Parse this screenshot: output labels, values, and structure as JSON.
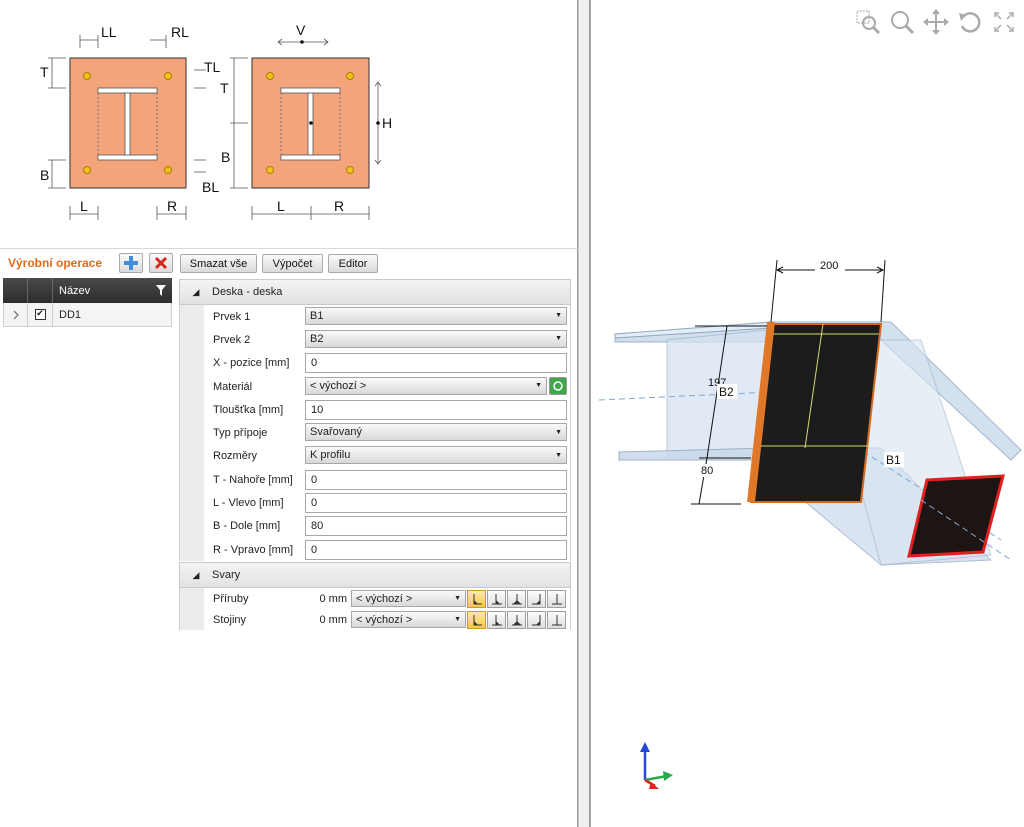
{
  "diagrams": {
    "left_labels": {
      "ll": "LL",
      "rl": "RL",
      "tl": "TL",
      "bl": "BL",
      "t": "T",
      "b": "B",
      "l": "L",
      "r": "R"
    },
    "right_labels": {
      "v": "V",
      "h": "H",
      "t": "T",
      "b": "B",
      "l": "L",
      "r": "R"
    },
    "plate_color": "#f4a47a"
  },
  "toolbar": {
    "title": "Výrobní operace",
    "delete_all": "Smazat vše",
    "calculate": "Výpočet",
    "editor": "Editor"
  },
  "operations": {
    "header_name": "Název",
    "rows": [
      {
        "name": "DD1",
        "checked": true
      }
    ]
  },
  "properties": {
    "section1_title": "Deska - deska",
    "rows": [
      {
        "label": "Prvek 1",
        "type": "select",
        "value": "B1"
      },
      {
        "label": "Prvek 2",
        "type": "select",
        "value": "B2"
      },
      {
        "label": "X - pozice [mm]",
        "type": "input",
        "value": "0"
      },
      {
        "label": "Materiál",
        "type": "select-btn",
        "value": "< výchozí >"
      },
      {
        "label": "Tloušťka [mm]",
        "type": "input",
        "value": "10"
      },
      {
        "label": "Typ přípoje",
        "type": "select",
        "value": "Svařovaný"
      },
      {
        "label": "Rozměry",
        "type": "select",
        "value": "K profilu"
      },
      {
        "label": "T - Nahoře [mm]",
        "type": "input",
        "value": "0"
      },
      {
        "label": "L - Vlevo [mm]",
        "type": "input",
        "value": "0"
      },
      {
        "label": "B - Dole [mm]",
        "type": "input",
        "value": "80"
      },
      {
        "label": "R - Vpravo [mm]",
        "type": "input",
        "value": "0"
      }
    ],
    "section2_title": "Svary",
    "welds": [
      {
        "label": "Příruby",
        "size": "0 mm",
        "type": "< výchozí >"
      },
      {
        "label": "Stojiny",
        "size": "0 mm",
        "type": "< výchozí >"
      }
    ]
  },
  "view3d": {
    "dim_width": "200",
    "dim_height": "197",
    "dim_bottom": "80",
    "member_b1": "B1",
    "member_b2": "B2"
  }
}
